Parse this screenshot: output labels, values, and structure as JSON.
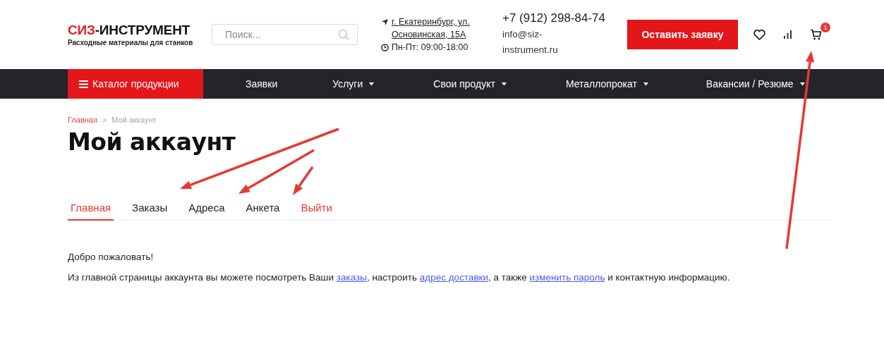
{
  "logo": {
    "brand_red": "СИЗ",
    "brand_dark": "-ИНСТРУМЕНТ",
    "tagline": "Расходные материалы для станков"
  },
  "search": {
    "placeholder": "Поиск..."
  },
  "address": {
    "lines": [
      "г. Екатеринбург, ул.",
      "Основинская, 15А"
    ],
    "hours": "Пн-Пт: 09:00-18:00"
  },
  "contacts": {
    "phone": "+7 (912) 298-84-74",
    "email_lines": [
      "info@siz-",
      "instrument.ru"
    ]
  },
  "request_button": "Оставить заявку",
  "cart": {
    "badge": "1"
  },
  "nav": [
    {
      "label": "Каталог продукции",
      "kind": "catalog"
    },
    {
      "label": "Заявки",
      "kind": "item",
      "dropdown": false
    },
    {
      "label": "Услуги",
      "kind": "item",
      "dropdown": true
    },
    {
      "label": "Свои продукт",
      "kind": "item",
      "dropdown": true
    },
    {
      "label": "Металлопрокат",
      "kind": "item",
      "dropdown": true
    },
    {
      "label": "Вакансии / Резюме",
      "kind": "item",
      "dropdown": true
    }
  ],
  "breadcrumbs": [
    {
      "label": "Главная",
      "kind": "link"
    },
    {
      "label": ">",
      "kind": "separator"
    },
    {
      "label": "Мой аккаунт",
      "kind": "current"
    }
  ],
  "page_title": "Мой аккаунт",
  "tabs": [
    {
      "label": "Главная",
      "selected": true,
      "kind": "tab"
    },
    {
      "label": "Заказы",
      "selected": false,
      "kind": "tab"
    },
    {
      "label": "Адреса",
      "selected": false,
      "kind": "tab"
    },
    {
      "label": "Анкета",
      "selected": false,
      "kind": "tab"
    },
    {
      "label": "Выйти",
      "selected": false,
      "kind": "logout"
    }
  ],
  "welcome": "Добро пожаловать!",
  "intro": [
    {
      "kind": "text",
      "text": "Из главной страницы аккаунта вы можете посмотреть Ваши "
    },
    {
      "kind": "link",
      "text": "заказы"
    },
    {
      "kind": "text",
      "text": ", настроить "
    },
    {
      "kind": "link",
      "text": "адрес доставки"
    },
    {
      "kind": "text",
      "text": ", а также "
    },
    {
      "kind": "link",
      "text": "изменить пароль"
    },
    {
      "kind": "text",
      "text": " и контактную информацию."
    }
  ],
  "annotations": [
    {
      "kind": "arrow"
    },
    {
      "kind": "arrow"
    },
    {
      "kind": "arrow"
    },
    {
      "kind": "arrow"
    }
  ]
}
